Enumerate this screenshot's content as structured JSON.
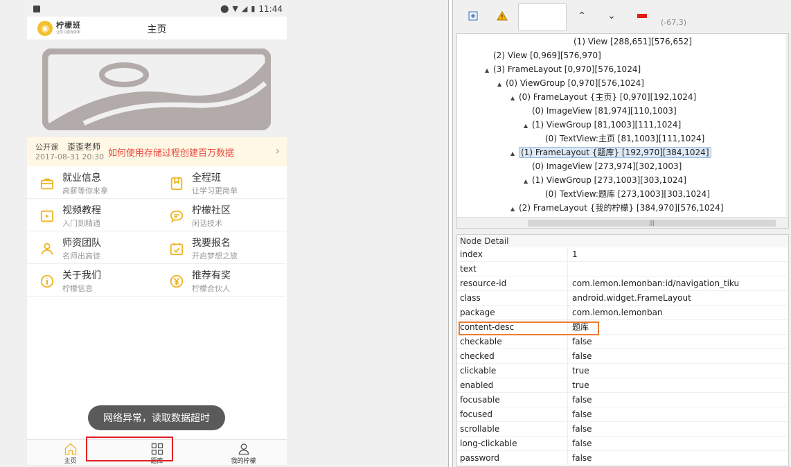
{
  "phone": {
    "status_time": "11:44",
    "header": {
      "title": "主页",
      "logo_name": "柠檬班",
      "logo_sub": "让学习更有效率"
    },
    "course": {
      "tag": "公开课",
      "teacher": "歪歪老师",
      "date": "2017-08-31 20:30",
      "title": "如何使用存储过程创建百万数据"
    },
    "menu": [
      {
        "title": "就业信息",
        "sub": "高薪等你来拿",
        "icon": "briefcase-icon"
      },
      {
        "title": "全程班",
        "sub": "让学习更简单",
        "icon": "bookmark-icon"
      },
      {
        "title": "视频教程",
        "sub": "入门到精通",
        "icon": "play-icon"
      },
      {
        "title": "柠檬社区",
        "sub": "闲话技术",
        "icon": "chat-icon"
      },
      {
        "title": "师资团队",
        "sub": "名师出高徒",
        "icon": "person-icon"
      },
      {
        "title": "我要报名",
        "sub": "开启梦想之旅",
        "icon": "calendar-check-icon"
      },
      {
        "title": "关于我们",
        "sub": "柠檬信息",
        "icon": "info-icon"
      },
      {
        "title": "推荐有奖",
        "sub": "柠檬合伙人",
        "icon": "yen-icon"
      }
    ],
    "toast": "网络异常，读取数据超时",
    "nav": [
      {
        "label": "主页",
        "icon": "home-icon"
      },
      {
        "label": "题库",
        "icon": "grid-icon"
      },
      {
        "label": "我的柠檬",
        "icon": "user-icon"
      }
    ],
    "accent": "#f0b31e",
    "highlight_color": "#e02020"
  },
  "toolbar": {
    "coords": "(-67,3)"
  },
  "tree": [
    {
      "text": "(1) View [288,651][576,652]",
      "expander": ""
    },
    {
      "text": "(2) View [0,969][576,970]",
      "expander": ""
    },
    {
      "text": "(3) FrameLayout [0,970][576,1024]",
      "expander": "▲"
    },
    {
      "text": "(0) ViewGroup [0,970][576,1024]",
      "expander": "▲"
    },
    {
      "text": "(0) FrameLayout {主页} [0,970][192,1024]",
      "expander": "▲"
    },
    {
      "text": "(0) ImageView [81,974][110,1003]",
      "expander": ""
    },
    {
      "text": "(1) ViewGroup [81,1003][111,1024]",
      "expander": "▲"
    },
    {
      "text": "(0) TextView:主页 [81,1003][111,1024]",
      "expander": ""
    },
    {
      "text": "(1) FrameLayout {题库} [192,970][384,1024]",
      "expander": "▲"
    },
    {
      "text": "(0) ImageView [273,974][302,1003]",
      "expander": ""
    },
    {
      "text": "(1) ViewGroup [273,1003][303,1024]",
      "expander": "▲"
    },
    {
      "text": "(0) TextView:题库 [273,1003][303,1024]",
      "expander": ""
    },
    {
      "text": "(2) FrameLayout {我的柠檬} [384,970][576,1024]",
      "expander": "▲"
    }
  ],
  "detail": {
    "title": "Node Detail",
    "rows": [
      {
        "key": "index",
        "value": "1"
      },
      {
        "key": "text",
        "value": ""
      },
      {
        "key": "resource-id",
        "value": "com.lemon.lemonban:id/navigation_tiku"
      },
      {
        "key": "class",
        "value": "android.widget.FrameLayout"
      },
      {
        "key": "package",
        "value": "com.lemon.lemonban"
      },
      {
        "key": "content-desc",
        "value": "题库"
      },
      {
        "key": "checkable",
        "value": "false"
      },
      {
        "key": "checked",
        "value": "false"
      },
      {
        "key": "clickable",
        "value": "true"
      },
      {
        "key": "enabled",
        "value": "true"
      },
      {
        "key": "focusable",
        "value": "false"
      },
      {
        "key": "focused",
        "value": "false"
      },
      {
        "key": "scrollable",
        "value": "false"
      },
      {
        "key": "long-clickable",
        "value": "false"
      },
      {
        "key": "password",
        "value": "false"
      }
    ],
    "highlight_color": "#ee7d2e"
  }
}
